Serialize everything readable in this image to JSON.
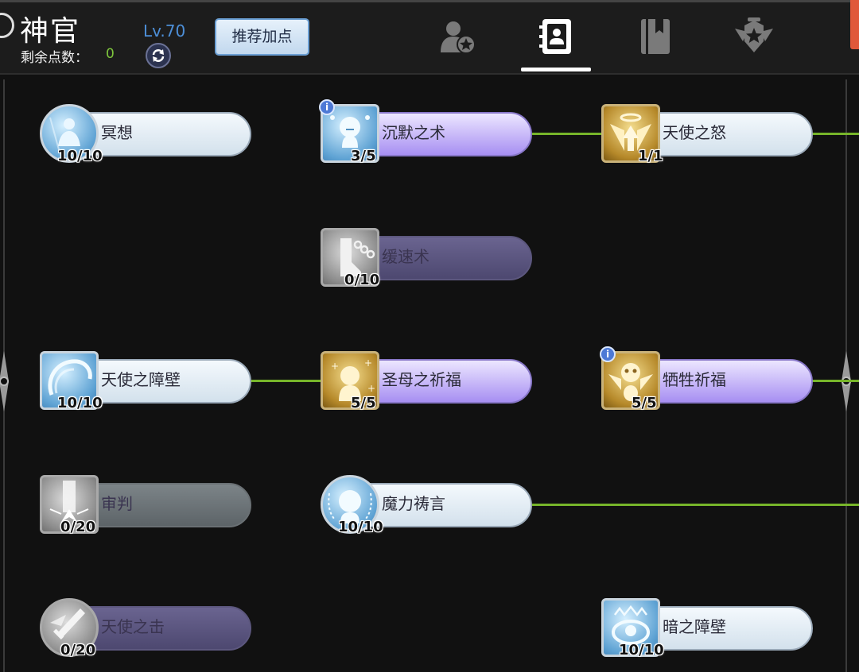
{
  "header": {
    "class_name": "神官",
    "points_label": "剩余点数：",
    "points_value": "0",
    "level": "Lv.70",
    "recommend_label": "推荐加点",
    "tabs": [
      {
        "icon": "profile-star-icon",
        "active": false
      },
      {
        "icon": "skill-book-icon",
        "active": true
      },
      {
        "icon": "journal-icon",
        "active": false
      },
      {
        "icon": "rank-emblem-icon",
        "active": false
      }
    ]
  },
  "skills": [
    {
      "name": "冥想",
      "count": "10/10",
      "icon": "meditation-icon"
    },
    {
      "name": "沉默之术",
      "count": "3/5",
      "icon": "silence-icon"
    },
    {
      "name": "天使之怒",
      "count": "1/1",
      "icon": "angel-wrath-icon"
    },
    {
      "name": "缓速术",
      "count": "0/10",
      "icon": "slow-icon"
    },
    {
      "name": "天使之障壁",
      "count": "10/10",
      "icon": "angel-barrier-icon"
    },
    {
      "name": "圣母之祈福",
      "count": "5/5",
      "icon": "holy-mother-blessing-icon"
    },
    {
      "name": "牺牲祈福",
      "count": "5/5",
      "icon": "sacrifice-blessing-icon"
    },
    {
      "name": "审判",
      "count": "0/20",
      "icon": "judgment-icon"
    },
    {
      "name": "魔力祷言",
      "count": "10/10",
      "icon": "mana-prayer-icon"
    },
    {
      "name": "天使之击",
      "count": "0/20",
      "icon": "angel-strike-icon"
    },
    {
      "name": "暗之障壁",
      "count": "10/10",
      "icon": "dark-barrier-icon"
    }
  ],
  "colors": {
    "accent_green": "#77b52a",
    "level_blue": "#4d8fd8",
    "points_green": "#7ec63c"
  }
}
